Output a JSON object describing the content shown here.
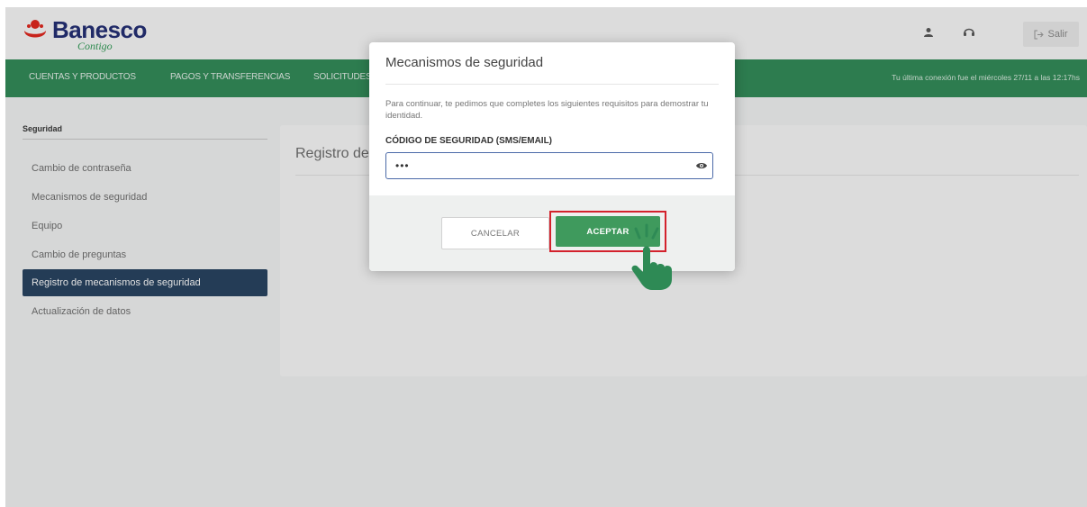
{
  "header": {
    "brand": "Banesco",
    "tagline": "Contigo",
    "exit_label": "Salir",
    "icons": [
      "user-icon",
      "support-headset-icon",
      "exit-icon"
    ]
  },
  "nav": {
    "items": [
      "CUENTAS Y PRODUCTOS",
      "PAGOS Y TRANSFERENCIAS",
      "SOLICITUDES"
    ],
    "last_connection": "Tu última conexión fue el miércoles 27/11 a las 12:17hs"
  },
  "sidebar": {
    "title": "Seguridad",
    "items": [
      {
        "label": "Cambio de contraseña",
        "active": false
      },
      {
        "label": "Mecanismos de seguridad",
        "active": false
      },
      {
        "label": "Equipo",
        "active": false
      },
      {
        "label": "Cambio de preguntas",
        "active": false
      },
      {
        "label": "Registro de mecanismos de seguridad",
        "active": true
      },
      {
        "label": "Actualización de datos",
        "active": false
      }
    ]
  },
  "main": {
    "title": "Registro de mecanismos de seguridad"
  },
  "modal": {
    "title": "Mecanismos de seguridad",
    "instructions": "Para continuar, te pedimos que completes los siguientes requisitos para demostrar tu identidad.",
    "field_label": "CÓDIGO DE SEGURIDAD (SMS/EMAIL)",
    "field_value": "•••",
    "cancel_label": "CANCELAR",
    "accept_label": "ACEPTAR"
  },
  "colors": {
    "nav_green": "#2e8a55",
    "accept_green": "#3f9a5d",
    "highlight_red": "#d3222c",
    "active_sidebar": "#233f5e",
    "brand_navy": "#1f2a72"
  }
}
